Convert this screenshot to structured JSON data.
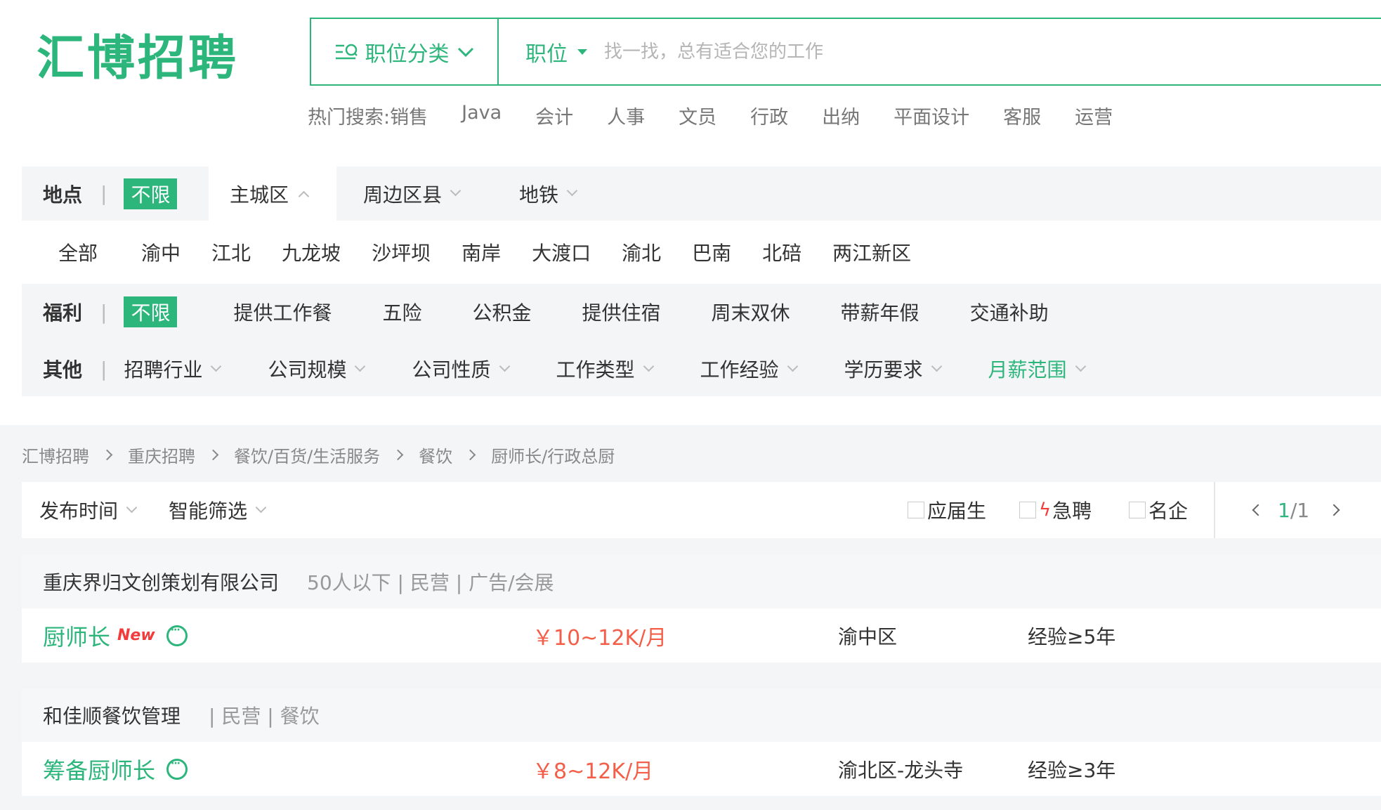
{
  "brand": {
    "logo": "汇博招聘",
    "accent_color": "#2db67c"
  },
  "search": {
    "category_label": "职位分类",
    "category_icon": "list-search-icon",
    "keyword_type": "职位",
    "placeholder": "找一找，总有适合您的工作"
  },
  "hot_search": {
    "label": "热门搜索:",
    "items": [
      "销售",
      "Java",
      "会计",
      "人事",
      "文员",
      "行政",
      "出纳",
      "平面设计",
      "客服",
      "运营"
    ]
  },
  "filters": {
    "location": {
      "label": "地点",
      "unlimited": "不限",
      "tabs": [
        "主城区",
        "周边区县",
        "地铁"
      ],
      "districts": [
        "全部",
        "渝中",
        "江北",
        "九龙坡",
        "沙坪坝",
        "南岸",
        "大渡口",
        "渝北",
        "巴南",
        "北碚",
        "两江新区"
      ]
    },
    "welfare": {
      "label": "福利",
      "unlimited": "不限",
      "items": [
        "提供工作餐",
        "五险",
        "公积金",
        "提供住宿",
        "周末双休",
        "带薪年假",
        "交通补助"
      ]
    },
    "other": {
      "label": "其他",
      "items": [
        "招聘行业",
        "公司规模",
        "公司性质",
        "工作类型",
        "工作经验",
        "学历要求",
        "月薪范围"
      ]
    }
  },
  "breadcrumb": [
    "汇博招聘",
    "重庆招聘",
    "餐饮/百货/生活服务",
    "餐饮",
    "厨师长/行政总厨"
  ],
  "toolbar": {
    "sort_time": "发布时间",
    "smart_filter": "智能筛选",
    "checks": [
      "应届生",
      "急聘",
      "名企"
    ],
    "page": "1",
    "page_total": "/1"
  },
  "jobs": [
    {
      "company": "重庆界归文创策划有限公司",
      "company_info": "50人以下 | 民营 | 广告/会展",
      "title": "厨师长",
      "badge": "New",
      "salary": "￥10~12K/月",
      "location": "渝中区",
      "experience": "经验≥5年"
    },
    {
      "company": "和佳顺餐饮管理",
      "company_info": "| 民营 | 餐饮",
      "title": "筹备厨师长",
      "badge": "",
      "salary": "￥8~12K/月",
      "location": "渝北区-龙头寺",
      "experience": "经验≥3年"
    }
  ]
}
